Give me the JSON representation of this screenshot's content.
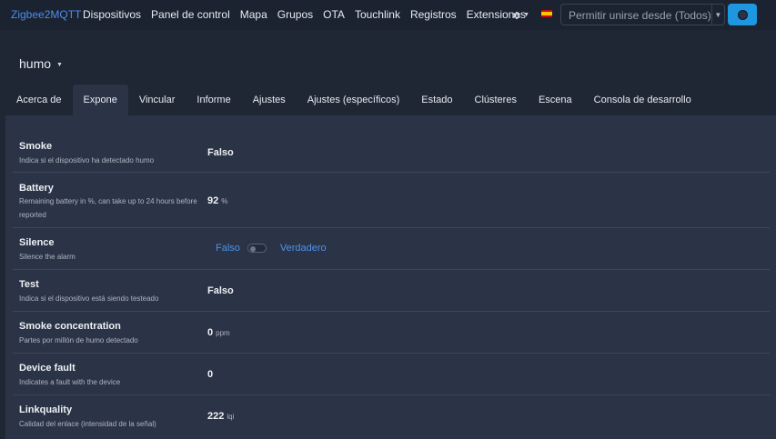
{
  "navbar": {
    "brand": "Zigbee2MQTT",
    "links": [
      "Dispositivos",
      "Panel de control",
      "Mapa",
      "Grupos",
      "OTA",
      "Touchlink",
      "Registros",
      "Extensiones"
    ],
    "settings_icon": "gear-icon",
    "language_icon": "spain-flag-icon",
    "permit_join_label": "Permitir unirse desde (Todos)",
    "permit_join_button_icon": "permit-join-icon"
  },
  "device": {
    "name": "humo"
  },
  "tabs": [
    "Acerca de",
    "Expone",
    "Vincular",
    "Informe",
    "Ajustes",
    "Ajustes (específicos)",
    "Estado",
    "Clústeres",
    "Escena",
    "Consola de desarrollo"
  ],
  "active_tab": "Expone",
  "exposes": {
    "smoke": {
      "name": "Smoke",
      "description": "Indica si el dispositivo ha detectado humo",
      "value": "Falso"
    },
    "battery": {
      "name": "Battery",
      "description": "Remaining battery in %, can take up to 24 hours before reported",
      "value": "92",
      "unit": "%"
    },
    "silence": {
      "name": "Silence",
      "description": "Silence the alarm",
      "off_label": "Falso",
      "on_label": "Verdadero",
      "state": false
    },
    "test": {
      "name": "Test",
      "description": "Indica si el dispositivo está siendo testeado",
      "value": "Falso"
    },
    "smoke_concentration": {
      "name": "Smoke concentration",
      "description": "Partes por millón de humo detectado",
      "value": "0",
      "unit": "ppm"
    },
    "device_fault": {
      "name": "Device fault",
      "description": "Indicates a fault with the device",
      "value": "0"
    },
    "linkquality": {
      "name": "Linkquality",
      "description": "Calidad del enlace (intensidad de la señal)",
      "value": "222",
      "unit": "lqi"
    }
  }
}
